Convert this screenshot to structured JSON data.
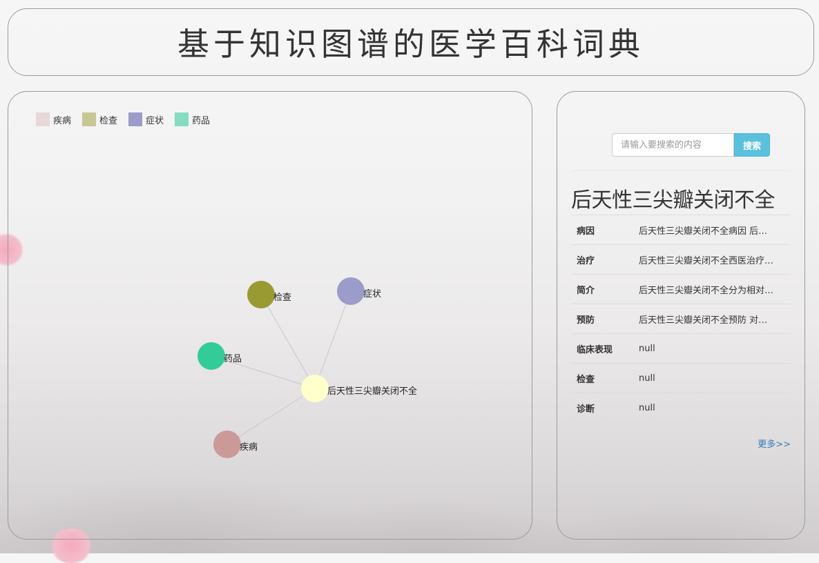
{
  "header": {
    "title": "基于知识图谱的医学百科词典"
  },
  "legend": [
    {
      "label": "疾病",
      "color": "#e6d8d6"
    },
    {
      "label": "检查",
      "color": "#c7c795"
    },
    {
      "label": "症状",
      "color": "#9b9cca"
    },
    {
      "label": "药品",
      "color": "#85dcc0"
    }
  ],
  "graph": {
    "nodes": [
      {
        "label": "检查",
        "color": "#9a9a32"
      },
      {
        "label": "症状",
        "color": "#9b9cca"
      },
      {
        "label": "药品",
        "color": "#33cc99"
      },
      {
        "label": "后天性三尖瓣关闭不全",
        "color": "#ffffcc"
      },
      {
        "label": "疾病",
        "color": "#cc9999"
      }
    ]
  },
  "search": {
    "placeholder": "请输入要搜索的内容",
    "button_label": "搜索"
  },
  "entity": {
    "title": "后天性三尖瓣关闭不全",
    "rows": [
      {
        "key": "病因",
        "value": "后天性三尖瓣关闭不全病因 后…"
      },
      {
        "key": "治疗",
        "value": "后天性三尖瓣关闭不全西医治疗…"
      },
      {
        "key": "简介",
        "value": "后天性三尖瓣关闭不全分为相对…"
      },
      {
        "key": "预防",
        "value": "后天性三尖瓣关闭不全预防 对…"
      },
      {
        "key": "临床表现",
        "value": "null"
      },
      {
        "key": "检查",
        "value": "null"
      },
      {
        "key": "诊断",
        "value": "null"
      }
    ]
  },
  "more_link": "更多>>"
}
